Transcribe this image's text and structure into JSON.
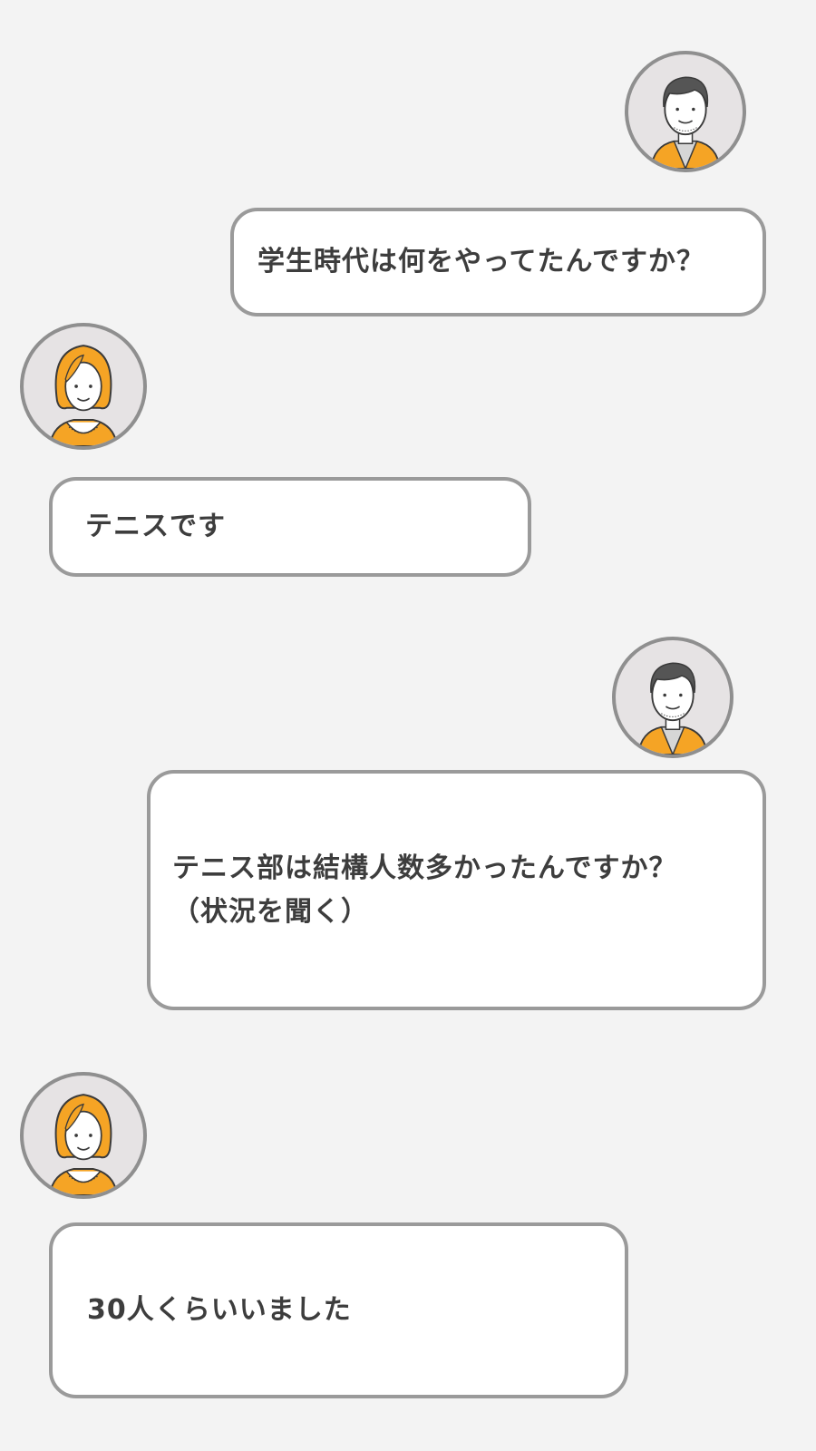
{
  "conversation": {
    "messages": [
      {
        "speaker": "man",
        "text": "学生時代は何をやってたんですか？"
      },
      {
        "speaker": "woman",
        "text": "テニスです"
      },
      {
        "speaker": "man",
        "text": "テニス部は結構人数多かったんですか？\n（状況を聞く）"
      },
      {
        "speaker": "woman",
        "text": "30人くらいいました"
      }
    ]
  },
  "colors": {
    "background": "#f3f3f3",
    "bubble_fill": "#ffffff",
    "bubble_border": "#9a9a9a",
    "text": "#3d3d3d",
    "avatar_ring": "#8f8f8f",
    "avatar_bg": "#e6e3e4",
    "accent_orange": "#f5a425"
  },
  "icons": {
    "man": "man-avatar-icon",
    "woman": "woman-avatar-icon"
  }
}
